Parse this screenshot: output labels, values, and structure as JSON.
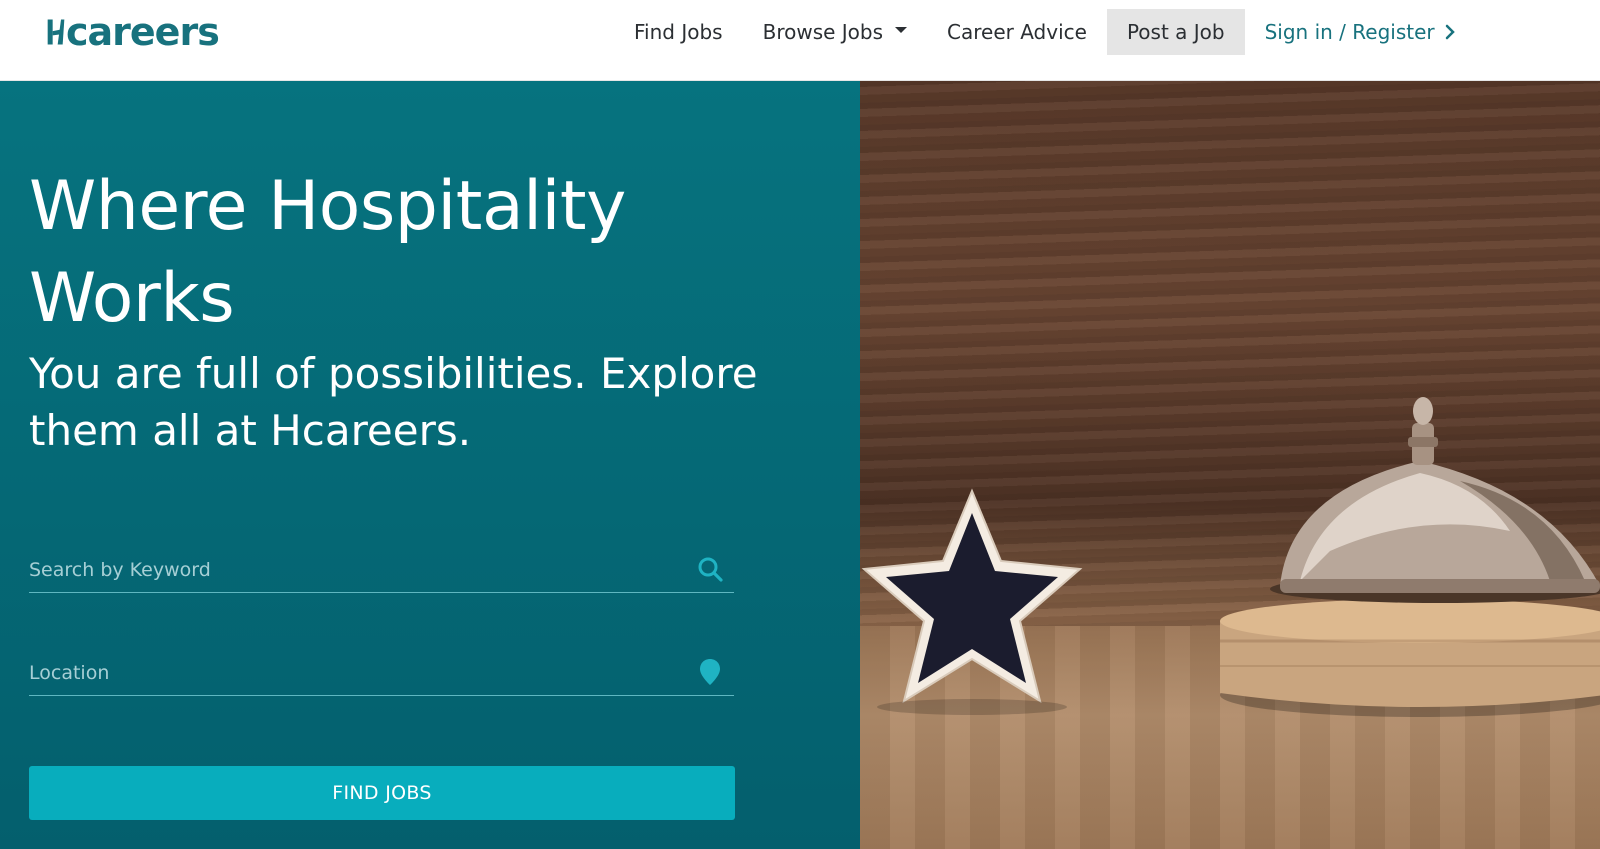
{
  "brand": {
    "logo_text": "careers",
    "logo_full": "Hcareers",
    "accent": "#18727e"
  },
  "nav": {
    "find_jobs": "Find Jobs",
    "browse_jobs": "Browse Jobs",
    "career_advice": "Career Advice",
    "post_job": "Post a Job",
    "sign_in": "Sign in / Register"
  },
  "hero": {
    "headline": "Where Hospitality Works",
    "subhead": "You are full of possibilities. Explore them all at Hcareers.",
    "keyword_placeholder": "Search by Keyword",
    "keyword_value": "",
    "location_placeholder": "Location",
    "location_value": "",
    "button_label": "FIND JOBS",
    "background": "#06737f",
    "button_color": "#08adbd"
  },
  "icons": {
    "search": "search-icon",
    "location": "map-pin-icon",
    "dropdown": "caret-down-icon",
    "chevron": "chevron-right-icon"
  }
}
